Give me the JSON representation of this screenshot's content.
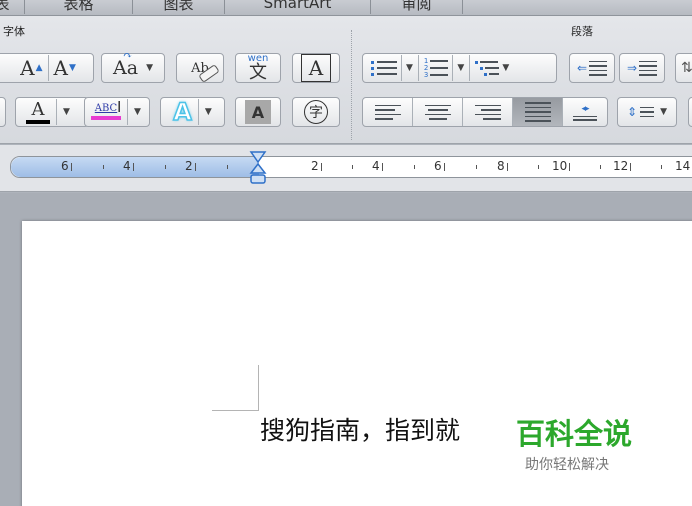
{
  "tabs": [
    {
      "id": "t0",
      "label": "表"
    },
    {
      "id": "t1",
      "label": "表格"
    },
    {
      "id": "t2",
      "label": "图表"
    },
    {
      "id": "t3",
      "label": "SmartArt"
    },
    {
      "id": "t4",
      "label": "审阅"
    }
  ],
  "ribbon": {
    "font_group_title": "字体",
    "paragraph_group_title": "段落",
    "grow_font_glyph": "A",
    "shrink_font_glyph": "A",
    "change_case_glyph": "Aa",
    "clear_format_glyph": "Ab",
    "phonetic_top": "wen",
    "phonetic_glyph": "文",
    "char_border_glyph": "A",
    "font_color_glyph": "A",
    "highlight_glyph": "ABC",
    "text_effect_glyph": "A",
    "char_shading_glyph": "A",
    "enclosed_char_glyph": "字",
    "colors": {
      "font_color_bar": "#000000",
      "highlight_bar": "#e83cd0",
      "text_effect": "#4cc3e8",
      "grow_arrow": "#2f70c8"
    }
  },
  "ruler": {
    "labels": [
      "6",
      "4",
      "2",
      "2",
      "4",
      "6",
      "8",
      "10",
      "12",
      "14"
    ]
  },
  "document": {
    "text_main": "搜狗指南，指到",
    "text_clipped": "就"
  },
  "watermark": {
    "title": "百科全说",
    "subtitle": "助你轻松解决"
  }
}
